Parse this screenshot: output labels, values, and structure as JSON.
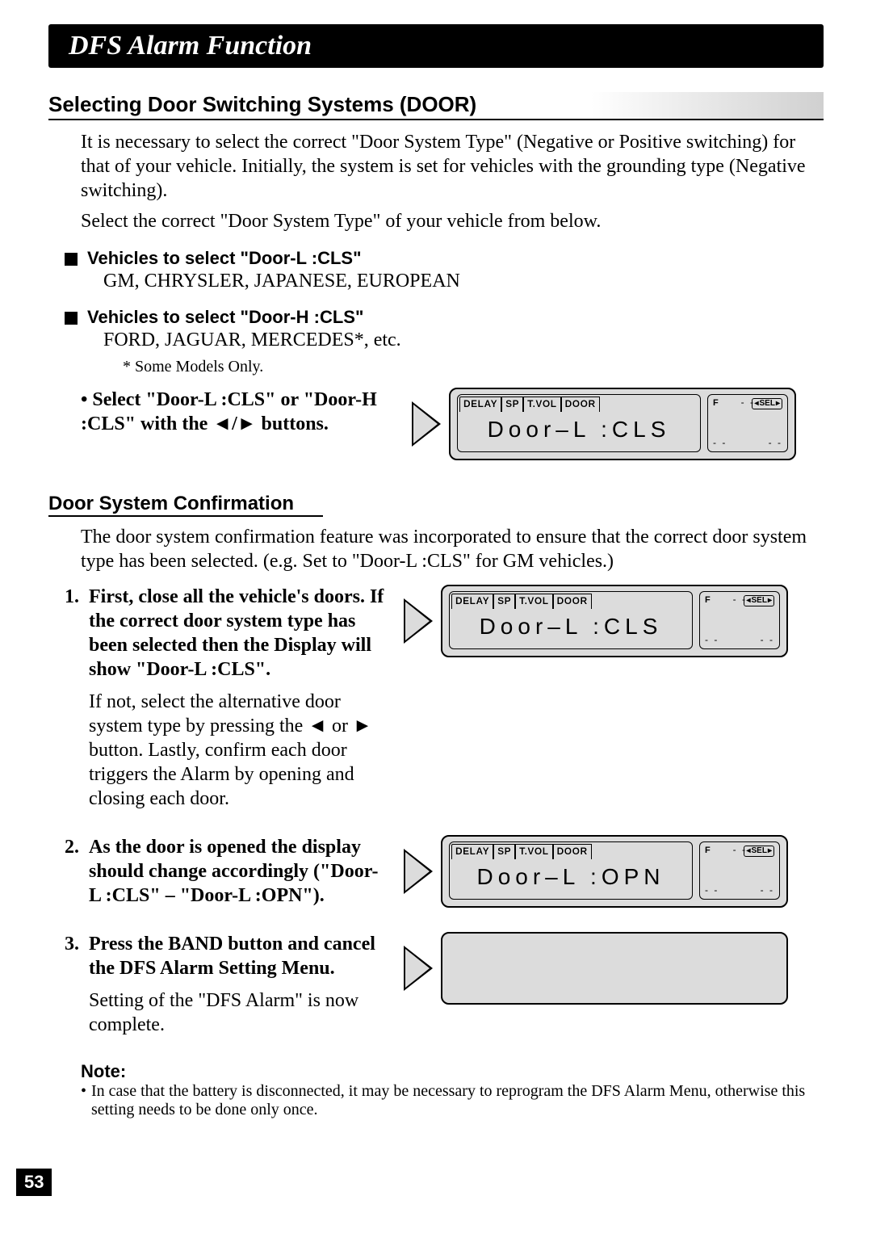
{
  "header": {
    "title": "DFS Alarm Function"
  },
  "page_number": "53",
  "section1": {
    "title": "Selecting Door Switching Systems (DOOR)",
    "para1": "It is necessary to select the correct \"Door System Type\" (Negative or Positive switching) for that of your vehicle. Initially, the system is set for vehicles with the grounding type (Negative switching).",
    "para2": "Select the correct \"Door System Type\" of your vehicle from below.",
    "g1_head": "Vehicles to select \"Door-L :CLS\"",
    "g1_body": "GM, CHRYSLER, JAPANESE, EUROPEAN",
    "g2_head": "Vehicles to select \"Door-H :CLS\"",
    "g2_body": "FORD, JAGUAR, MERCEDES*, etc.",
    "g2_note": "*  Some Models Only.",
    "select_instruction": "Select \"Door-L :CLS\" or \"Door-H :CLS\" with the ◄/► buttons."
  },
  "section2": {
    "title": "Door System Confirmation",
    "intro": "The door system confirmation feature was incorporated to ensure that the correct door system type has been selected. (e.g. Set to \"Door-L :CLS\" for GM vehicles.)",
    "step1": "First, close all the vehicle's doors. If the correct door system type has been selected then the Display will show \"Door-L :CLS\".",
    "step1_sub": "If not, select the alternative door system type by pressing the ◄ or ► button. Lastly, confirm each door triggers the Alarm by opening and closing each door.",
    "step2": "As the door is opened the display should change accordingly (\"Door-L :CLS\" – \"Door-L :OPN\").",
    "step3": "Press the BAND button and cancel the DFS Alarm Setting Menu.",
    "step3_sub": "Setting of the \"DFS Alarm\" is now complete."
  },
  "note": {
    "head": "Note:",
    "body": "In case that the battery is disconnected, it may be necessary to reprogram the DFS Alarm Menu, otherwise this setting needs to be done only once."
  },
  "lcd": {
    "tabs": [
      "DELAY",
      "SP",
      "T.VOL",
      "DOOR"
    ],
    "sel": "SEL",
    "f": "F",
    "d1": "Door–L    :CLS",
    "d2": "Door–L    :CLS",
    "d3": "Door–L    :OPN"
  }
}
